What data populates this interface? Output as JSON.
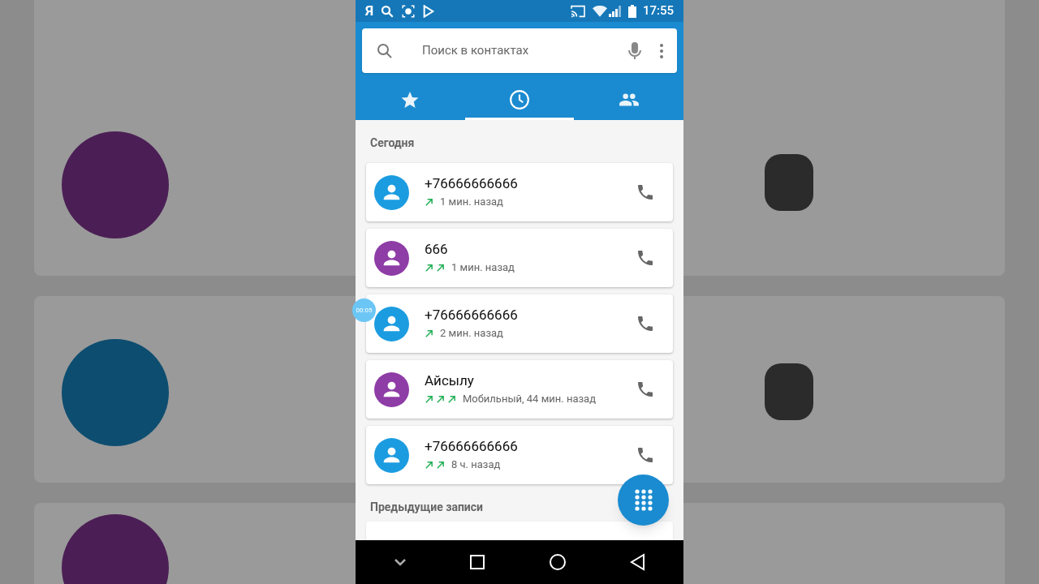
{
  "status_bar": {
    "app_glyph": "Я",
    "time": "17:55"
  },
  "search": {
    "placeholder": "Поиск в контактах"
  },
  "tabs": [
    {
      "kind": "favorites",
      "selected": false
    },
    {
      "kind": "recent",
      "selected": true
    },
    {
      "kind": "contacts",
      "selected": false
    }
  ],
  "sections": [
    {
      "title": "Сегодня",
      "calls": [
        {
          "name": "+76666666666",
          "color": "#1b9ce0",
          "calls_made": [
            {
              "kind": "outgoing"
            }
          ],
          "detail": "1 мин. назад"
        },
        {
          "name": "666",
          "color": "#8e3ca6",
          "calls_made": [
            {
              "kind": "outgoing"
            },
            {
              "kind": "outgoing"
            }
          ],
          "detail": "1 мин. назад"
        },
        {
          "name": "+76666666666",
          "color": "#1b9ce0",
          "calls_made": [
            {
              "kind": "outgoing"
            }
          ],
          "detail": "2 мин. назад"
        },
        {
          "name": "Айсылу",
          "color": "#8e3ca6",
          "calls_made": [
            {
              "kind": "outgoing"
            },
            {
              "kind": "outgoing"
            },
            {
              "kind": "outgoing"
            }
          ],
          "detail": "Мобильный, 44 мин. назад"
        },
        {
          "name": "+76666666666",
          "color": "#1b9ce0",
          "calls_made": [
            {
              "kind": "outgoing"
            },
            {
              "kind": "outgoing"
            }
          ],
          "detail": "8 ч. назад"
        }
      ]
    },
    {
      "title": "Предыдущие записи"
    }
  ],
  "call_timer": "00:05"
}
